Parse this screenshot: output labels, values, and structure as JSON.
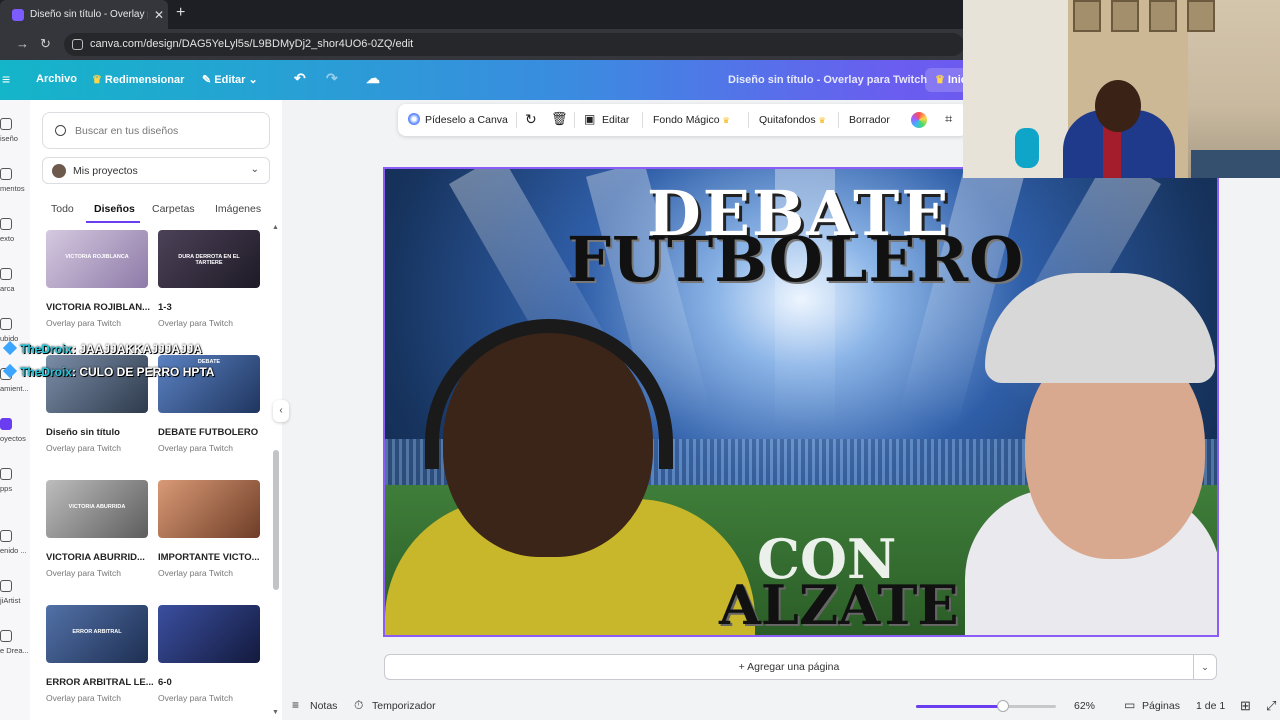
{
  "browser": {
    "tab_title": "Diseño sin título - Overlay para",
    "tab_close": "✕",
    "new_tab": "+",
    "url": "canva.com/design/DAG5YeLyl5s/L9BDMyDj2_shor4UO6-0ZQ/edit"
  },
  "topbar": {
    "menu": "≡",
    "file": "Archivo",
    "resize": "Redimensionar",
    "edit": "Editar",
    "doc_name": "Diseño sin título - Overlay para Twitch",
    "start": "Inic"
  },
  "rail": [
    {
      "label": "iseño",
      "icon": "design-icon"
    },
    {
      "label": "mentos",
      "icon": "elements-icon"
    },
    {
      "label": "exto",
      "icon": "text-icon"
    },
    {
      "label": "arca",
      "icon": "brand-icon"
    },
    {
      "label": "ubido",
      "icon": "uploads-icon"
    },
    {
      "label": "amient...",
      "icon": "tools-icon"
    },
    {
      "label": "oyectos",
      "icon": "projects-icon"
    },
    {
      "label": "pps",
      "icon": "apps-icon"
    },
    {
      "label": "enido ...",
      "icon": "magic-icon"
    },
    {
      "label": "jiArtist",
      "icon": "artist-icon"
    },
    {
      "label": "e Drea...",
      "icon": "dream-icon"
    }
  ],
  "panel": {
    "search_placeholder": "Buscar en tus diseños",
    "projects_selector": "Mis proyectos",
    "tabs": [
      "Todo",
      "Diseños",
      "Carpetas",
      "Imágenes"
    ],
    "active_tab": "Diseños",
    "cards": [
      {
        "title": "VICTORIA ROJIBLAN...",
        "sub": "Overlay para Twitch",
        "caption": "VICTORIA ROJIBLANCA",
        "color": "#b8a9c9"
      },
      {
        "title": "1-3",
        "sub": "Overlay para Twitch",
        "caption": "DURA DERROTA EN EL TARTIERE",
        "color": "#3a3346"
      },
      {
        "title": "Diseño sin título",
        "sub": "Overlay para Twitch",
        "caption": "",
        "color": "#5b6d88"
      },
      {
        "title": "DEBATE FUTBOLERO",
        "sub": "Overlay para Twitch",
        "caption": "DEBATE",
        "color": "#4a6fa8"
      },
      {
        "title": "VICTORIA ABURRID...",
        "sub": "Overlay para Twitch",
        "caption": "VICTORIA ABURRIDA",
        "color": "#8f8f8f"
      },
      {
        "title": "IMPORTANTE VICTO...",
        "sub": "Overlay para Twitch",
        "caption": "",
        "color": "#c77a52"
      },
      {
        "title": "ERROR ARBITRAL LE...",
        "sub": "Overlay para Twitch",
        "caption": "ERROR ARBITRAL",
        "color": "#2f4f89"
      },
      {
        "title": "6-0",
        "sub": "Overlay para Twitch",
        "caption": "",
        "color": "#2b3a7a"
      }
    ]
  },
  "chat": [
    {
      "user": "TheDroix",
      "message": ": JAAJJAKKAJJJAJJA"
    },
    {
      "user": "TheDroix",
      "message": ": CULO DE PERRO HPTA"
    }
  ],
  "context_toolbar": {
    "ask": "Pídeselo a Canva",
    "edit": "Editar",
    "magic_bg": "Fondo Mágico",
    "remove_bg": "Quitafondos",
    "eraser": "Borrador"
  },
  "canvas": {
    "line1": "DEBATE",
    "line2": "FUTBOLERO",
    "line3": "CON",
    "line4": "ALZATE"
  },
  "add_page": "+ Agregar una página",
  "bottombar": {
    "notes": "Notas",
    "timer": "Temporizador",
    "zoom": "62%",
    "zoom_fraction": 0.62,
    "pages": "Páginas",
    "page_count": "1 de 1"
  },
  "colors": {
    "accent": "#6a3df0",
    "canvas_border": "#8b5cf6",
    "chat_user": "#26c6da"
  }
}
